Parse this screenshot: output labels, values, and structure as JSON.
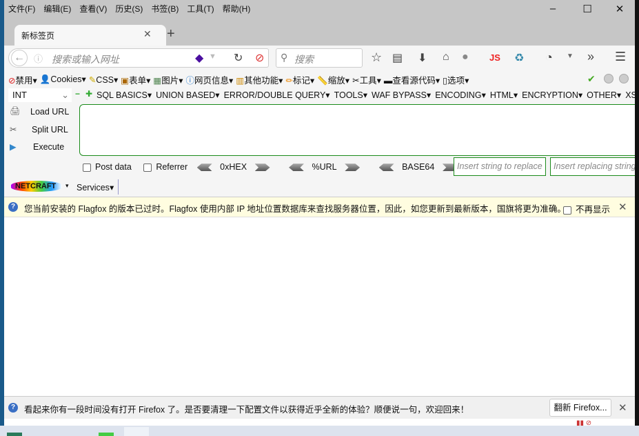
{
  "menubar": [
    "文件(F)",
    "编辑(E)",
    "查看(V)",
    "历史(S)",
    "书签(B)",
    "工具(T)",
    "帮助(H)"
  ],
  "tab": {
    "title": "新标签页"
  },
  "navbar": {
    "url_placeholder": "搜索或输入网址",
    "search_placeholder": "搜索",
    "js_label": "JS"
  },
  "toolbar2": [
    "禁用",
    "Cookies",
    "CSS",
    "表单",
    "图片",
    "网页信息",
    "其他功能",
    "标记",
    "缩放",
    "工具",
    "查看源代码",
    "选项"
  ],
  "hackbar": {
    "select": "INT",
    "menus": [
      "SQL BASICS",
      "UNION BASED",
      "ERROR/DOUBLE QUERY",
      "TOOLS",
      "WAF BYPASS",
      "ENCODING",
      "HTML",
      "ENCRYPTION",
      "OTHER",
      "XSS"
    ],
    "load_url": "Load URL",
    "split_url": "Split URL",
    "execute": "Execute",
    "url_value": "",
    "post_data": "Post data",
    "referrer": "Referrer",
    "hex": "0xHEX",
    "url_enc": "%URL",
    "base64": "BASE64",
    "replace_placeholder": "Insert string to replace",
    "replacing_placeholder": "Insert replacing string"
  },
  "netcraft": {
    "logo": "NETCRAFT",
    "services": "Services"
  },
  "notice": {
    "text": "您当前安装的 Flagfox 的版本已过时。Flagfox 使用内部 IP 地址位置数据库来查找服务器位置，因此，如您更新到最新版本，国旗将更为准确。",
    "dont_show": "不再显示"
  },
  "bottom": {
    "text": "看起来你有一段时间没有打开 Firefox 了。是否要清理一下配置文件以获得近乎全新的体验？顺便说一句，欢迎回来！",
    "refresh": "翻新 Firefox..."
  },
  "colors": {
    "accent_green": "#1a8a1a",
    "titlebar": "#c6c6c6",
    "notice_bg": "#fffde0"
  }
}
